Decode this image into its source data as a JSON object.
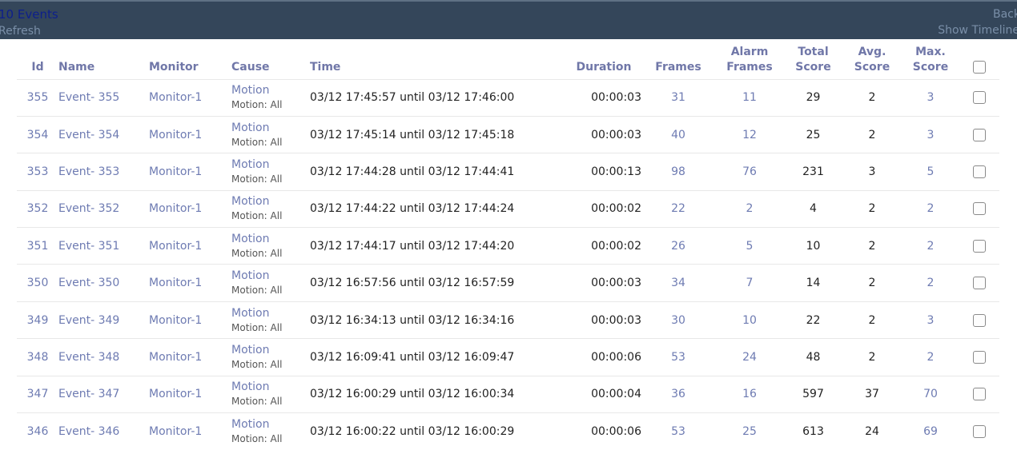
{
  "header": {
    "title": "10 Events",
    "refresh": "Refresh",
    "back": "Back",
    "timeline": "Show Timeline"
  },
  "columns": {
    "id": "Id",
    "name": "Name",
    "monitor": "Monitor",
    "cause": "Cause",
    "time": "Time",
    "duration": "Duration",
    "frames": "Frames",
    "alarm_frames_1": "Alarm",
    "alarm_frames_2": "Frames",
    "total_score_1": "Total",
    "total_score_2": "Score",
    "avg_score_1": "Avg.",
    "avg_score_2": "Score",
    "max_score_1": "Max.",
    "max_score_2": "Score"
  },
  "rows": [
    {
      "id": "355",
      "name": "Event- 355",
      "monitor": "Monitor-1",
      "cause": "Motion",
      "cause_detail": "Motion: All",
      "time": "03/12 17:45:57 until 03/12 17:46:00",
      "duration": "00:00:03",
      "frames": "31",
      "alarm_frames": "11",
      "total_score": "29",
      "avg_score": "2",
      "max_score": "3"
    },
    {
      "id": "354",
      "name": "Event- 354",
      "monitor": "Monitor-1",
      "cause": "Motion",
      "cause_detail": "Motion: All",
      "time": "03/12 17:45:14 until 03/12 17:45:18",
      "duration": "00:00:03",
      "frames": "40",
      "alarm_frames": "12",
      "total_score": "25",
      "avg_score": "2",
      "max_score": "3"
    },
    {
      "id": "353",
      "name": "Event- 353",
      "monitor": "Monitor-1",
      "cause": "Motion",
      "cause_detail": "Motion: All",
      "time": "03/12 17:44:28 until 03/12 17:44:41",
      "duration": "00:00:13",
      "frames": "98",
      "alarm_frames": "76",
      "total_score": "231",
      "avg_score": "3",
      "max_score": "5"
    },
    {
      "id": "352",
      "name": "Event- 352",
      "monitor": "Monitor-1",
      "cause": "Motion",
      "cause_detail": "Motion: All",
      "time": "03/12 17:44:22 until 03/12 17:44:24",
      "duration": "00:00:02",
      "frames": "22",
      "alarm_frames": "2",
      "total_score": "4",
      "avg_score": "2",
      "max_score": "2"
    },
    {
      "id": "351",
      "name": "Event- 351",
      "monitor": "Monitor-1",
      "cause": "Motion",
      "cause_detail": "Motion: All",
      "time": "03/12 17:44:17 until 03/12 17:44:20",
      "duration": "00:00:02",
      "frames": "26",
      "alarm_frames": "5",
      "total_score": "10",
      "avg_score": "2",
      "max_score": "2"
    },
    {
      "id": "350",
      "name": "Event- 350",
      "monitor": "Monitor-1",
      "cause": "Motion",
      "cause_detail": "Motion: All",
      "time": "03/12 16:57:56 until 03/12 16:57:59",
      "duration": "00:00:03",
      "frames": "34",
      "alarm_frames": "7",
      "total_score": "14",
      "avg_score": "2",
      "max_score": "2"
    },
    {
      "id": "349",
      "name": "Event- 349",
      "monitor": "Monitor-1",
      "cause": "Motion",
      "cause_detail": "Motion: All",
      "time": "03/12 16:34:13 until 03/12 16:34:16",
      "duration": "00:00:03",
      "frames": "30",
      "alarm_frames": "10",
      "total_score": "22",
      "avg_score": "2",
      "max_score": "3"
    },
    {
      "id": "348",
      "name": "Event- 348",
      "monitor": "Monitor-1",
      "cause": "Motion",
      "cause_detail": "Motion: All",
      "time": "03/12 16:09:41 until 03/12 16:09:47",
      "duration": "00:00:06",
      "frames": "53",
      "alarm_frames": "24",
      "total_score": "48",
      "avg_score": "2",
      "max_score": "2"
    },
    {
      "id": "347",
      "name": "Event- 347",
      "monitor": "Monitor-1",
      "cause": "Motion",
      "cause_detail": "Motion: All",
      "time": "03/12 16:00:29 until 03/12 16:00:34",
      "duration": "00:00:04",
      "frames": "36",
      "alarm_frames": "16",
      "total_score": "597",
      "avg_score": "37",
      "max_score": "70"
    },
    {
      "id": "346",
      "name": "Event- 346",
      "monitor": "Monitor-1",
      "cause": "Motion",
      "cause_detail": "Motion: All",
      "time": "03/12 16:00:22 until 03/12 16:00:29",
      "duration": "00:00:06",
      "frames": "53",
      "alarm_frames": "25",
      "total_score": "613",
      "avg_score": "24",
      "max_score": "69"
    }
  ]
}
